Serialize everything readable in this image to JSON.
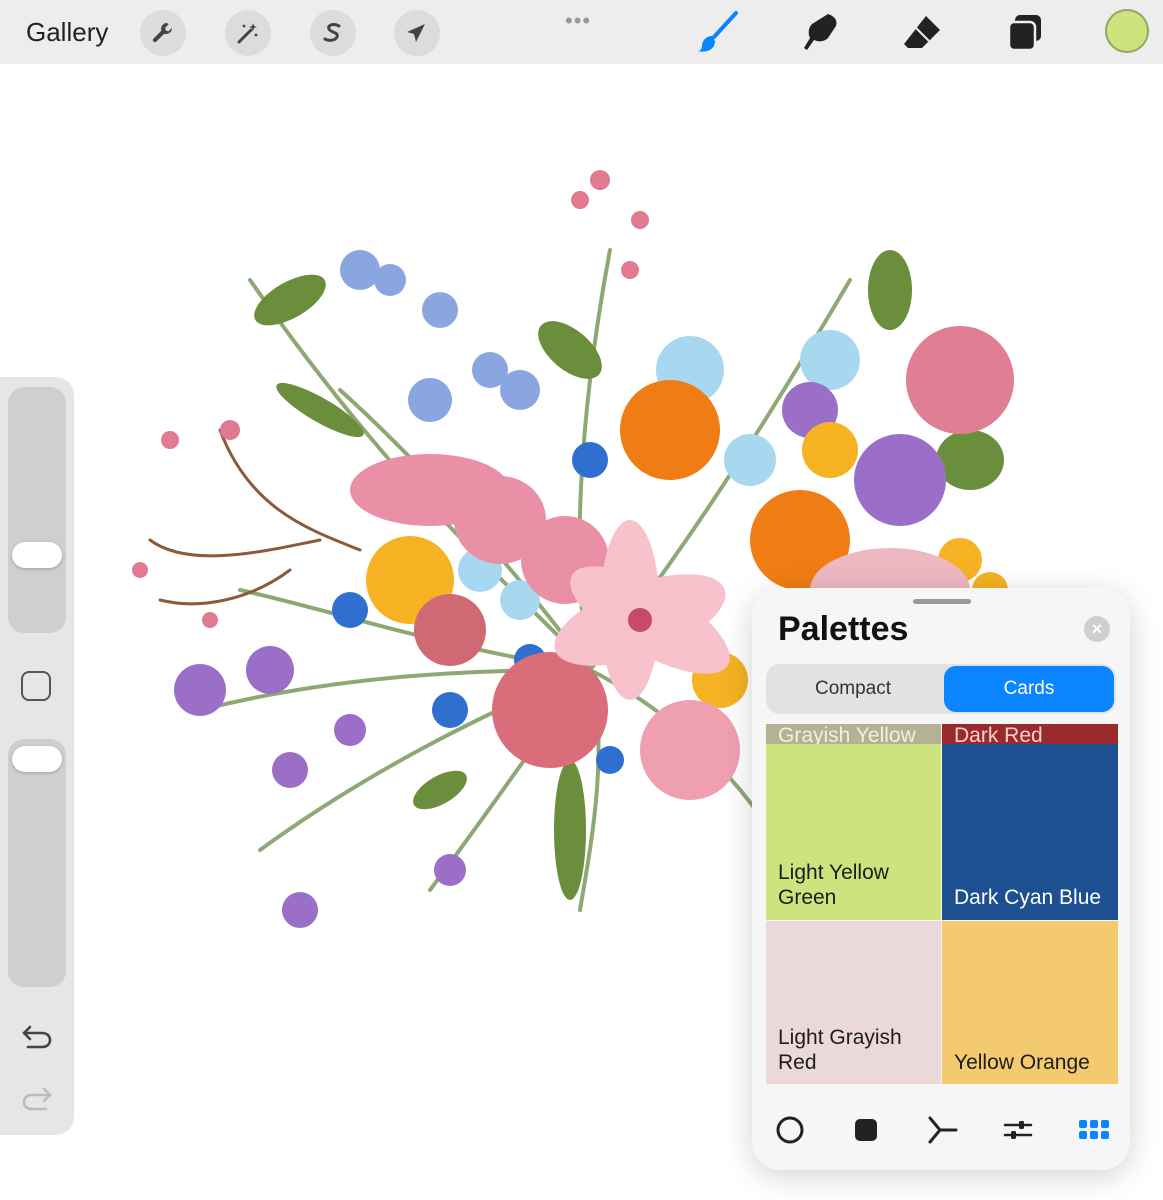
{
  "topbar": {
    "gallery_label": "Gallery",
    "menu_dots": "•••",
    "current_color": "#cde37e"
  },
  "panel": {
    "title": "Palettes",
    "close_glyph": "×",
    "tabs": [
      {
        "label": "Compact",
        "active": false
      },
      {
        "label": "Cards",
        "active": true
      }
    ],
    "cards": [
      {
        "name": "Grayish Yellow",
        "color": "#b5b293"
      },
      {
        "name": "Dark Red",
        "color": "#9b2a2d"
      },
      {
        "name": "Light Yellow Green",
        "color": "#cde37e"
      },
      {
        "name": "Dark Cyan Blue",
        "color": "#1c5090"
      },
      {
        "name": "Light Grayish Red",
        "color": "#ebd9d9"
      },
      {
        "name": "Yellow Orange",
        "color": "#f4ca6e"
      }
    ]
  },
  "accent_color": "#0a84ff"
}
